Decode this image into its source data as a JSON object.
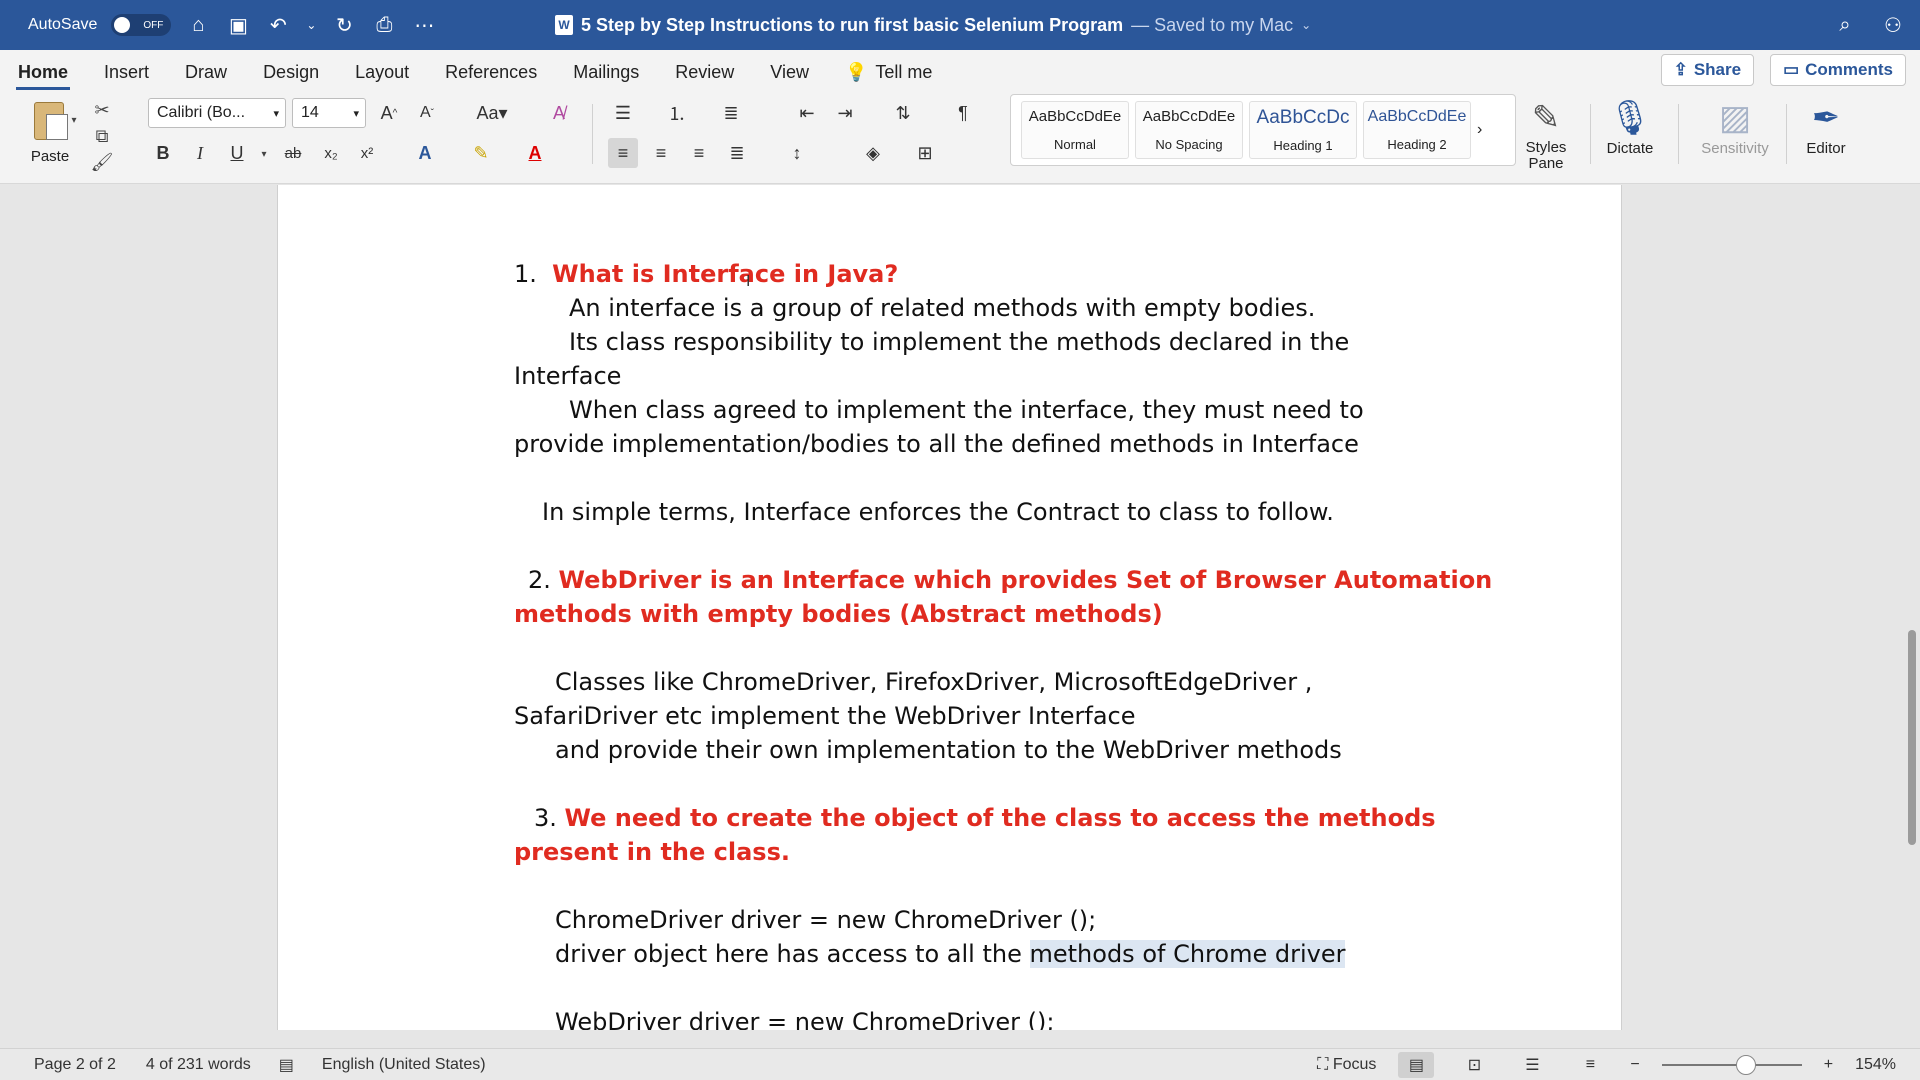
{
  "titlebar": {
    "autosave_label": "AutoSave",
    "autosave_state": "OFF",
    "doc_title": "5 Step by Step Instructions to run first basic Selenium Program",
    "saved_status": "— Saved to my Mac",
    "icons": [
      "home-icon",
      "save-icon",
      "undo-icon",
      "redo-icon",
      "print-icon",
      "more-icon",
      "search-icon",
      "share-people-icon"
    ]
  },
  "tabs": [
    "Home",
    "Insert",
    "Draw",
    "Design",
    "Layout",
    "References",
    "Mailings",
    "Review",
    "View"
  ],
  "tell_me": "Tell me",
  "share_label": "Share",
  "comments_label": "Comments",
  "ribbon": {
    "paste_label": "Paste",
    "font_name": "Calibri (Bo...",
    "font_size": "14",
    "grow_font": "A^",
    "shrink_font": "Aˇ",
    "change_case": "Aa",
    "bold": "B",
    "italic": "I",
    "underline": "U",
    "strike": "ab",
    "subscript": "x₂",
    "superscript": "x²",
    "styles": [
      {
        "preview": "AaBbCcDdEe",
        "name": "Normal"
      },
      {
        "preview": "AaBbCcDdEe",
        "name": "No Spacing"
      },
      {
        "preview": "AaBbCcDc",
        "name": "Heading 1"
      },
      {
        "preview": "AaBbCcDdEe",
        "name": "Heading 2"
      }
    ],
    "styles_pane": "Styles\nPane",
    "dictate": "Dictate",
    "sensitivity": "Sensitivity",
    "editor": "Editor"
  },
  "document": {
    "h1_num": "1.",
    "h1": "What is Interface in Java?",
    "p1": "An interface is a group of related methods with empty bodies.",
    "p2a": "Its class responsibility to implement the methods declared in the",
    "p2b": "Interface",
    "p3a": "When class agreed to implement the interface, they must need to",
    "p3b": "provide implementation/bodies to all the defined methods in Interface",
    "p4": "In simple terms, Interface enforces the Contract to class to follow.",
    "h2_num": "2.",
    "h2a": "WebDriver is an Interface which provides Set of Browser Automation",
    "h2b": "methods with empty bodies (Abstract methods)",
    "p5a": "Classes like ChromeDriver, FirefoxDriver, MicrosoftEdgeDriver ,",
    "p5b": "SafariDriver etc implement the WebDriver Interface",
    "p5c": "and provide their own implementation to the WebDriver methods",
    "h3_num": "3.",
    "h3a": "We need to create the object of the class to access the methods",
    "h3b": "present in the class.",
    "code1": "ChromeDriver driver = new ChromeDriver ();",
    "p6_pre": "driver object here has access to all the ",
    "p6_sel": "methods of Chrome driver",
    "code2": "WebDriver driver = new ChromeDriver ();"
  },
  "status": {
    "page": "Page 2 of 2",
    "words": "4 of 231 words",
    "language": "English (United States)",
    "focus": "Focus",
    "zoom": "154%"
  },
  "colors": {
    "titlebar": "#2b579a",
    "heading_red": "#e02b20",
    "selection": "#dce6f2"
  }
}
